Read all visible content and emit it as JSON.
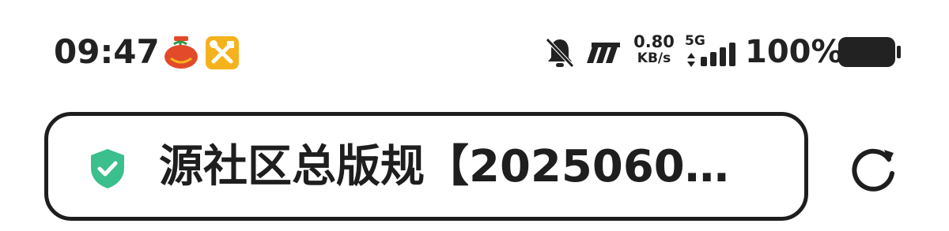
{
  "status_bar": {
    "time": "09:47",
    "notification_icons": [
      "tomato-app-icon",
      "tools-app-icon"
    ],
    "net_speed_value": "0.80",
    "net_speed_unit": "KB/s",
    "network_type": "5G",
    "battery_percent": "100%",
    "status_icons": [
      "bell-muted-icon",
      "mi-icon",
      "data-arrows-icon",
      "signal-icon",
      "battery-icon"
    ]
  },
  "address_bar": {
    "security_icon": "shield-check-icon",
    "page_title": "源社区总版规【2025060…",
    "refresh_icon": "refresh-icon"
  },
  "colors": {
    "shield": "#3bbf8c",
    "tools_app": "#f6b21c",
    "tomato_app": "#e24a2a",
    "text": "#1e1e1e"
  }
}
